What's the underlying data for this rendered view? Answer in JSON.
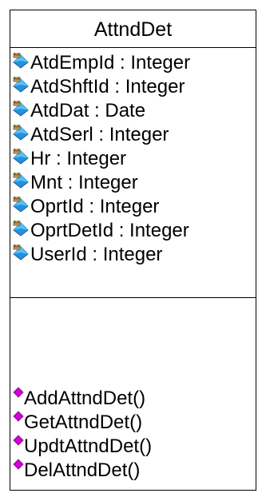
{
  "class_box": {
    "name": "AttndDet",
    "attributes": [
      {
        "label": "AtdEmpId : Integer",
        "icon": "protected-attribute-icon"
      },
      {
        "label": "AtdShftId : Integer",
        "icon": "protected-attribute-icon"
      },
      {
        "label": "AtdDat : Date",
        "icon": "protected-attribute-icon"
      },
      {
        "label": "AtdSerl : Integer",
        "icon": "protected-attribute-icon"
      },
      {
        "label": "Hr : Integer",
        "icon": "protected-attribute-icon"
      },
      {
        "label": "Mnt : Integer",
        "icon": "protected-attribute-icon"
      },
      {
        "label": "OprtId : Integer",
        "icon": "protected-attribute-icon"
      },
      {
        "label": "OprtDetId : Integer",
        "icon": "protected-attribute-icon"
      },
      {
        "label": "UserId : Integer",
        "icon": "protected-attribute-icon"
      }
    ],
    "operations": [
      {
        "label": "AddAttndDet()",
        "icon": "public-operation-icon"
      },
      {
        "label": "GetAttndDet()",
        "icon": "public-operation-icon"
      },
      {
        "label": "UpdtAttndDet()",
        "icon": "public-operation-icon"
      },
      {
        "label": "DelAttndDet()",
        "icon": "public-operation-icon"
      }
    ],
    "colors": {
      "border": "#000000",
      "text": "#000000",
      "attribute_icon_top": "#4fc3ff",
      "attribute_icon_body": "#2a8fd6",
      "attribute_key": "#c9a25a",
      "operation_icon": "#d400d4"
    }
  }
}
